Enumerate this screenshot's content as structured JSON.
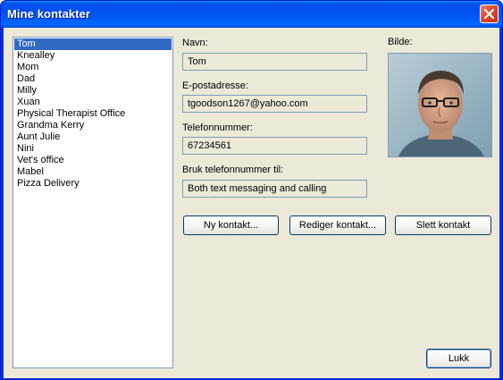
{
  "window": {
    "title": "Mine kontakter",
    "close_icon": "close-icon"
  },
  "contacts": {
    "items": [
      "Tom",
      "Knealley",
      "Mom",
      "Dad",
      "Milly",
      "Xuan",
      "Physical Therapist Office",
      "Grandma Kerry",
      "Aunt Julie",
      "Nini",
      "Vet's office",
      "Mabel",
      "Pizza Delivery"
    ],
    "selected": "Tom"
  },
  "details": {
    "name_label": "Navn:",
    "name_value": "Tom",
    "email_label": "E-postadresse:",
    "email_value": "tgoodson1267@yahoo.com",
    "phone_label": "Telefonnummer:",
    "phone_value": "67234561",
    "usage_label": "Bruk telefonnummer til:",
    "usage_value": "Both text messaging and calling",
    "photo_label": "Bilde:"
  },
  "buttons": {
    "new_contact": "Ny kontakt...",
    "edit_contact": "Rediger kontakt...",
    "delete_contact": "Slett kontakt",
    "close": "Lukk"
  },
  "colors": {
    "titlebar": "#0058ee",
    "selection": "#316ac5",
    "dialog_bg": "#ece9d8",
    "close_button": "#dd4a2b"
  }
}
